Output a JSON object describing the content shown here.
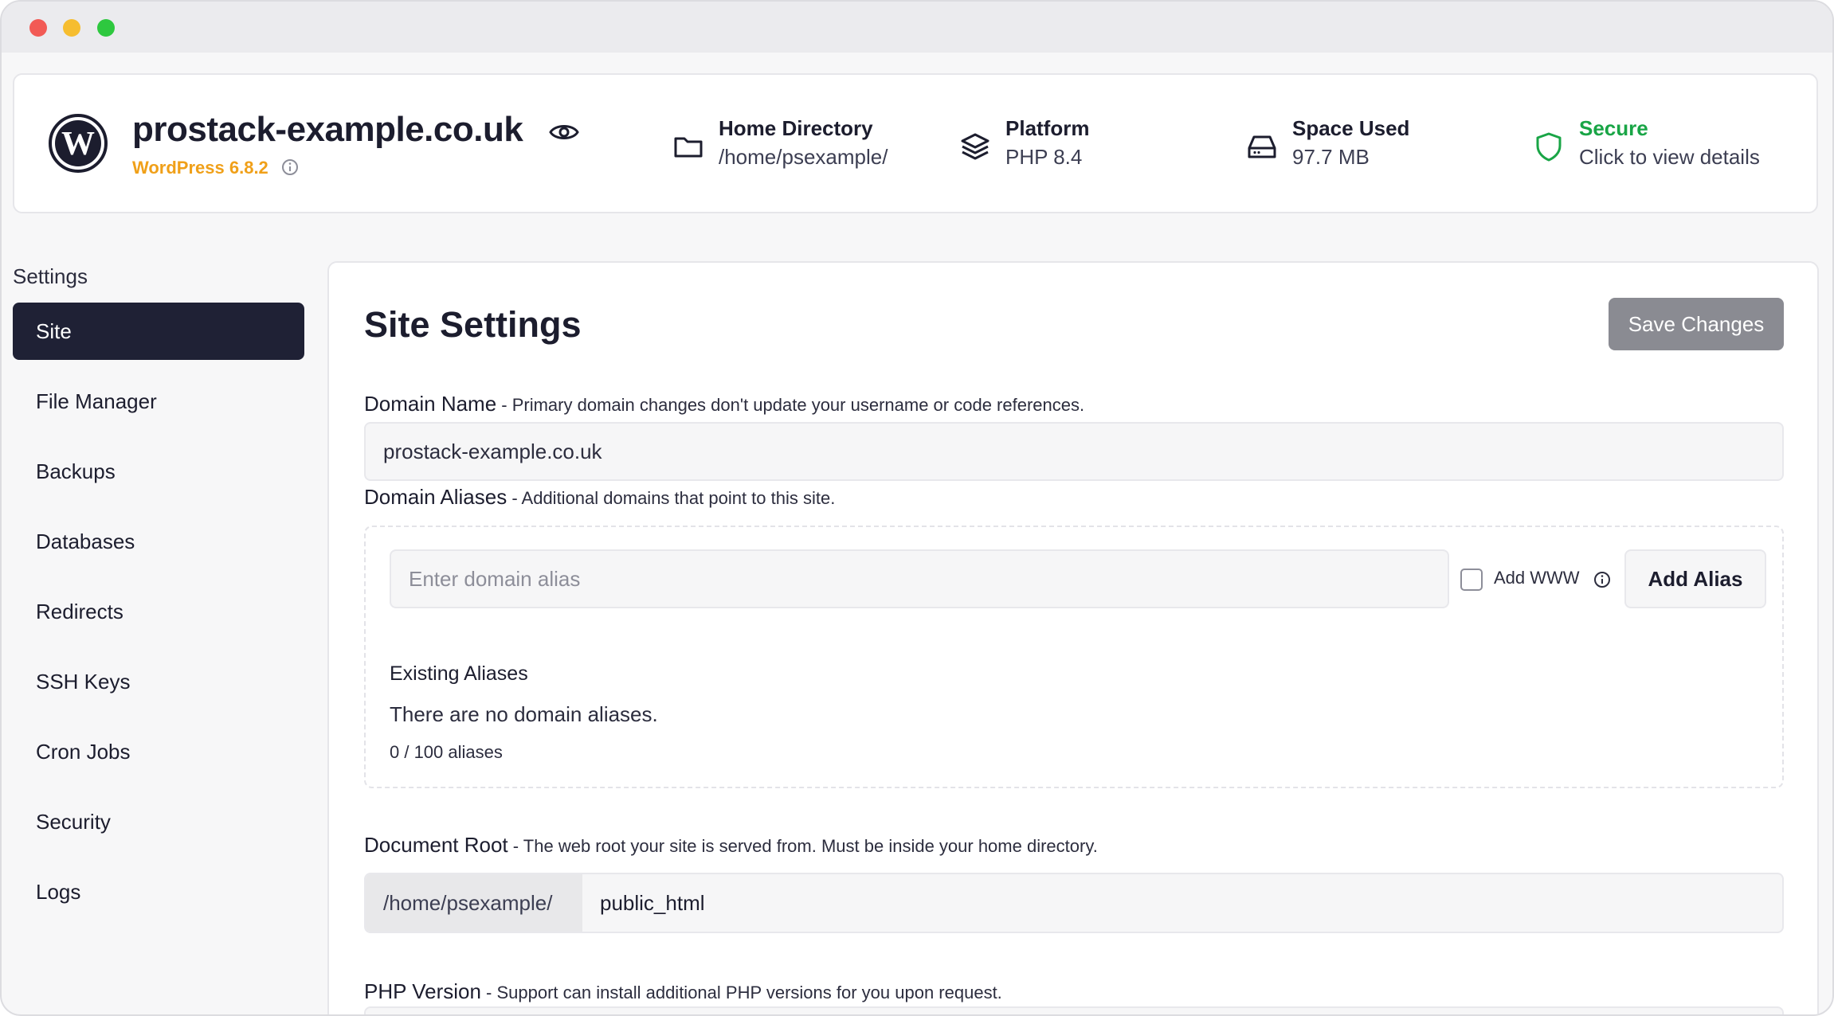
{
  "header": {
    "site_name": "prostack-example.co.uk",
    "wp_version": "WordPress 6.8.2",
    "home_dir_label": "Home Directory",
    "home_dir_value": "/home/psexample/",
    "platform_label": "Platform",
    "platform_value": "PHP 8.4",
    "space_label": "Space Used",
    "space_value": "97.7 MB",
    "secure_label": "Secure",
    "secure_value": "Click to view details"
  },
  "sidebar": {
    "heading": "Settings",
    "items": [
      {
        "label": "Site",
        "active": true
      },
      {
        "label": "File Manager"
      },
      {
        "label": "Backups"
      },
      {
        "label": "Databases"
      },
      {
        "label": "Redirects"
      },
      {
        "label": "SSH Keys"
      },
      {
        "label": "Cron Jobs"
      },
      {
        "label": "Security"
      },
      {
        "label": "Logs"
      }
    ]
  },
  "main": {
    "title": "Site Settings",
    "save_label": "Save Changes",
    "domain_name": {
      "label": "Domain Name",
      "help": " - Primary domain changes don't update your username or code references.",
      "value": "prostack-example.co.uk"
    },
    "domain_aliases": {
      "label": "Domain Aliases",
      "help": " - Additional domains that point to this site.",
      "placeholder": "Enter domain alias",
      "add_www_label": "Add WWW",
      "add_alias_label": "Add Alias",
      "existing_title": "Existing Aliases",
      "empty_text": "There are no domain aliases.",
      "count_text": "0 / 100 aliases"
    },
    "document_root": {
      "label": "Document Root",
      "help": " - The web root your site is served from. Must be inside your home directory.",
      "prefix": "/home/psexample/",
      "value": "public_html"
    },
    "php_version": {
      "label": "PHP Version",
      "help": " - Support can install additional PHP versions for you upon request."
    }
  },
  "colors": {
    "accent_dark": "#1f2135",
    "wp_orange": "#f0a019",
    "secure_green": "#19a546"
  }
}
